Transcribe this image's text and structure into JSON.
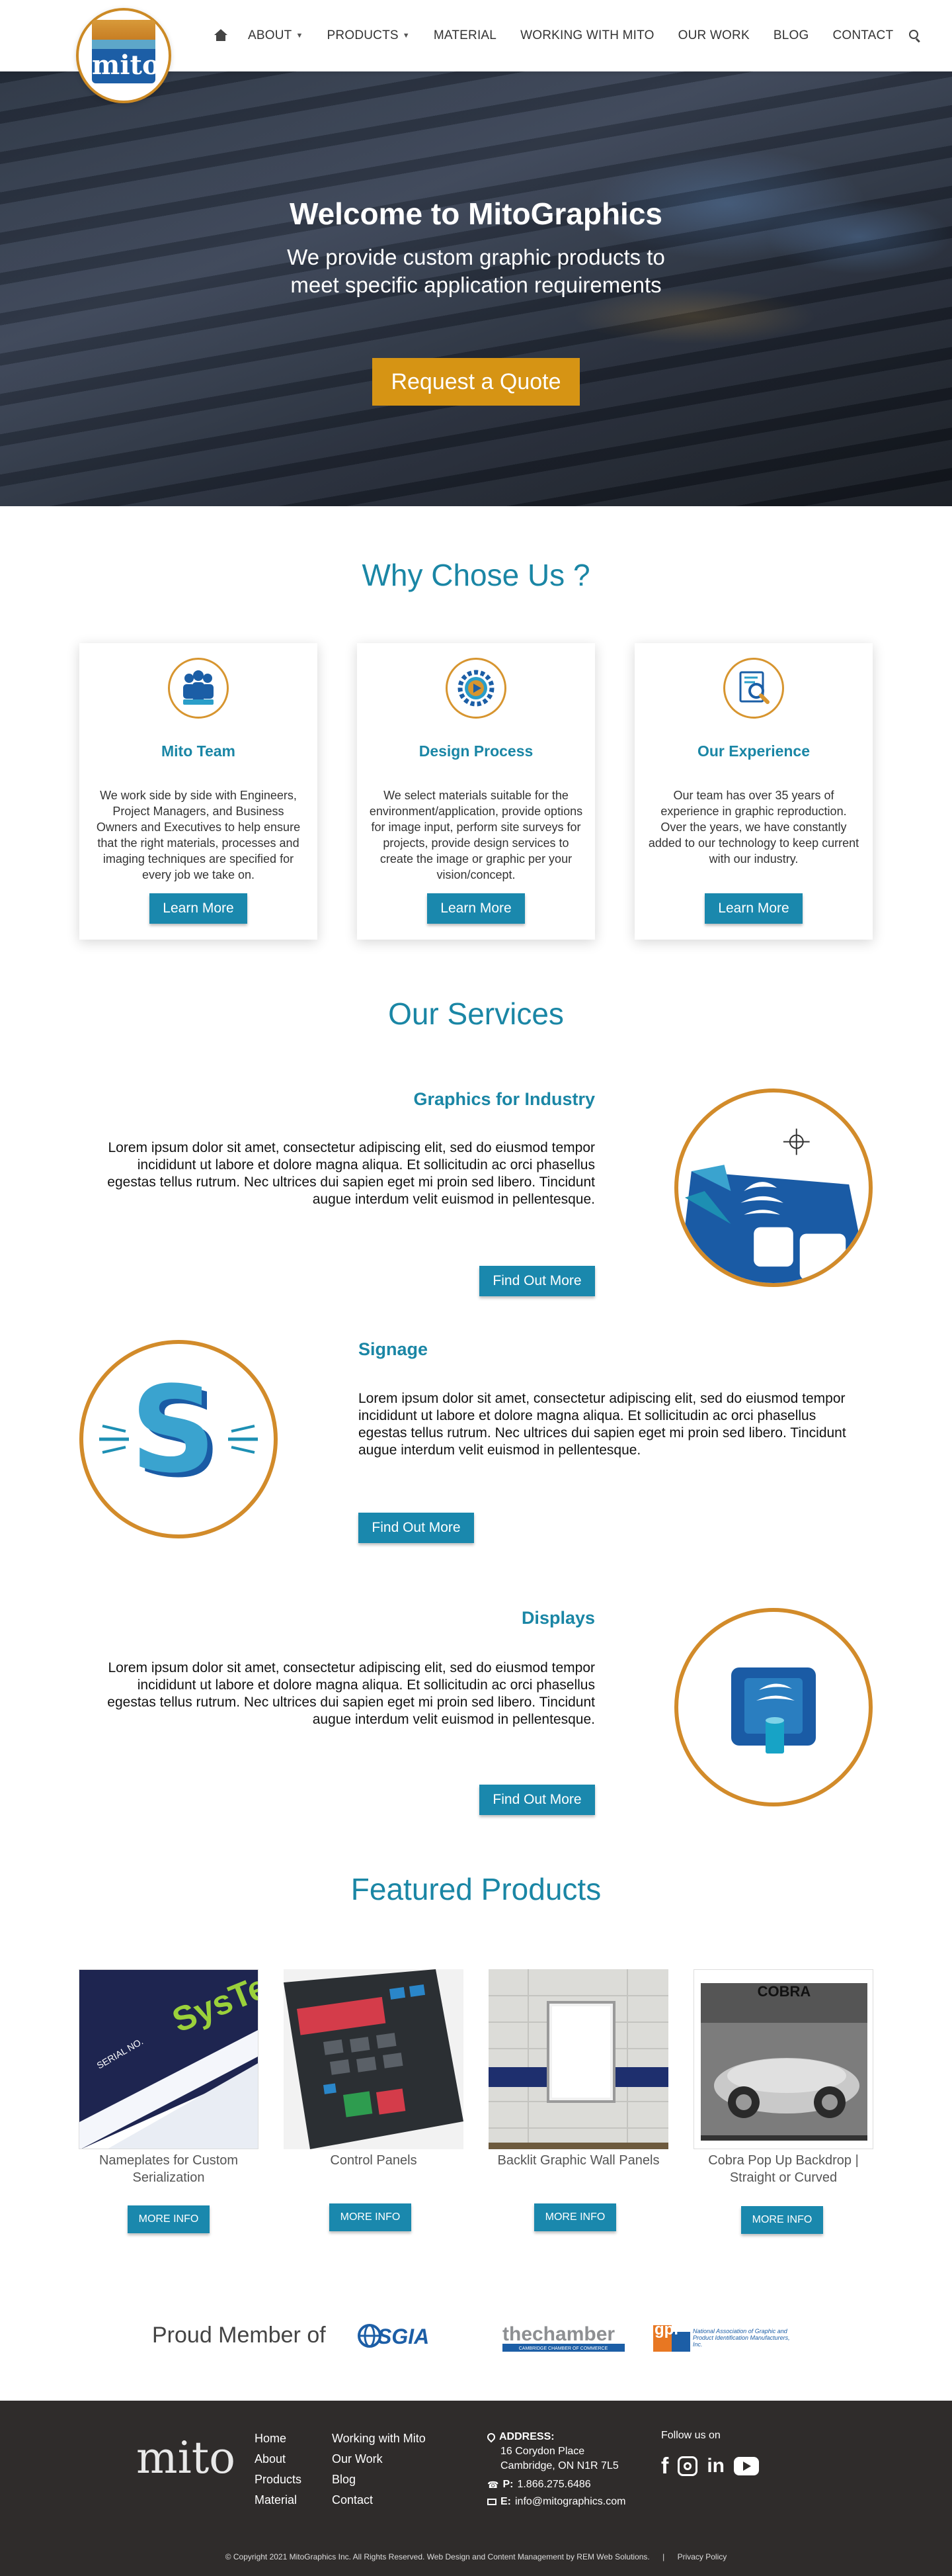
{
  "nav": {
    "items": [
      {
        "label": "ABOUT",
        "dropdown": true
      },
      {
        "label": "PRODUCTS",
        "dropdown": true
      },
      {
        "label": "MATERIAL",
        "dropdown": false
      },
      {
        "label": "WORKING WITH MITO",
        "dropdown": false
      },
      {
        "label": "OUR WORK",
        "dropdown": false
      },
      {
        "label": "BLOG",
        "dropdown": false
      },
      {
        "label": "CONTACT",
        "dropdown": false
      }
    ],
    "logo_text": "mito"
  },
  "hero": {
    "title": "Welcome to MitoGraphics",
    "subtitle": "We provide custom graphic products  to meet specific application requirements",
    "cta": "Request  a Quote"
  },
  "why": {
    "title": "Why Chose Us ?",
    "cards": [
      {
        "icon": "team-icon",
        "title": "Mito Team",
        "text": "We work side by side with Engineers, Project Managers, and Business Owners and Executives  to help ensure that the right materials, processes and imaging techniques are specified for every job we take on.",
        "button": "Learn More"
      },
      {
        "icon": "design-process-icon",
        "title": "Design Process",
        "text": "We select materials suitable for the environment/application, provide options for image input, perform site surveys for projects, provide design services to create the image or graphic per your vision/concept.",
        "button": "Learn More"
      },
      {
        "icon": "experience-icon",
        "title": "Our Experience",
        "text": "Our team has over 35 years of experience in graphic reproduction. Over the years, we have constantly added to our technology to keep current with our industry.",
        "button": "Learn More"
      }
    ]
  },
  "services": {
    "title": "Our Services",
    "items": [
      {
        "title": "Graphics for Industry",
        "text": "Lorem ipsum dolor sit amet, consectetur adipiscing elit, sed do eiusmod tempor incididunt ut labore et dolore magna aliqua. Et sollicitudin ac orci phasellus egestas tellus rutrum. Nec ultrices dui sapien eget mi proin sed libero. Tincidunt augue interdum velit euismod in pellentesque.",
        "button": "Find Out More",
        "icon": "industry-graphic-icon"
      },
      {
        "title": "Signage",
        "text": "Lorem ipsum dolor sit amet, consectetur adipiscing elit, sed do eiusmod tempor incididunt ut labore et dolore magna aliqua. Et sollicitudin ac orci phasellus egestas tellus rutrum. Nec ultrices dui sapien eget mi proin sed libero. Tincidunt augue interdum velit euismod in pellentesque.",
        "button": "Find Out More",
        "icon": "signage-s-icon"
      },
      {
        "title": "Displays",
        "text": "Lorem ipsum dolor sit amet, consectetur adipiscing elit, sed do eiusmod tempor incididunt ut labore et dolore magna aliqua. Et sollicitudin ac orci phasellus egestas tellus rutrum. Nec ultrices dui sapien eget mi proin sed libero. Tincidunt augue interdum velit euismod in pellentesque.",
        "button": "Find Out More",
        "icon": "display-stand-icon"
      }
    ]
  },
  "products": {
    "title": "Featured Products",
    "items": [
      {
        "name": "Nameplates for Custom Serialization",
        "button": "MORE INFO",
        "image_text": "SERIAL NO."
      },
      {
        "name": "Control Panels",
        "button": "MORE INFO"
      },
      {
        "name": "Backlit Graphic Wall Panels",
        "button": "MORE INFO"
      },
      {
        "name": "Cobra Pop Up Backdrop | Straight or Curved",
        "button": "MORE INFO",
        "image_text": "COBRA"
      }
    ]
  },
  "members": {
    "label": "Proud Member of",
    "logos": [
      {
        "name": "SGIA"
      },
      {
        "name": "thechamber",
        "sub": "CAMBRIDGE CHAMBER OF COMMERCE"
      },
      {
        "name": "gpi",
        "sub": "National Association of Graphic and Product Identification Manufacturers, Inc."
      }
    ]
  },
  "footer": {
    "logo_text": "mito",
    "col1": [
      "Home",
      "About",
      "Products",
      "Material"
    ],
    "col2": [
      "Working with Mito",
      "Our Work",
      "Blog",
      "Contact"
    ],
    "address_label": "ADDRESS:",
    "address_line1": "16 Corydon Place",
    "address_line2": "Cambridge, ON N1R 7L5",
    "phone_label": "P:",
    "phone": "1.866.275.6486",
    "email_label": "E:",
    "email": "info@mitographics.com",
    "follow": "Follow us on",
    "copyright": "© Copyright 2021 MitoGraphics Inc. All Rights Reserved. Web Design and Content Management by REM Web Solutions.",
    "divider": "|",
    "privacy": "Privacy Policy"
  },
  "colors": {
    "accent": "#1a86a5",
    "cta": "#d69414",
    "border": "#d28b2a",
    "footer_bg": "#2f2c2b"
  }
}
